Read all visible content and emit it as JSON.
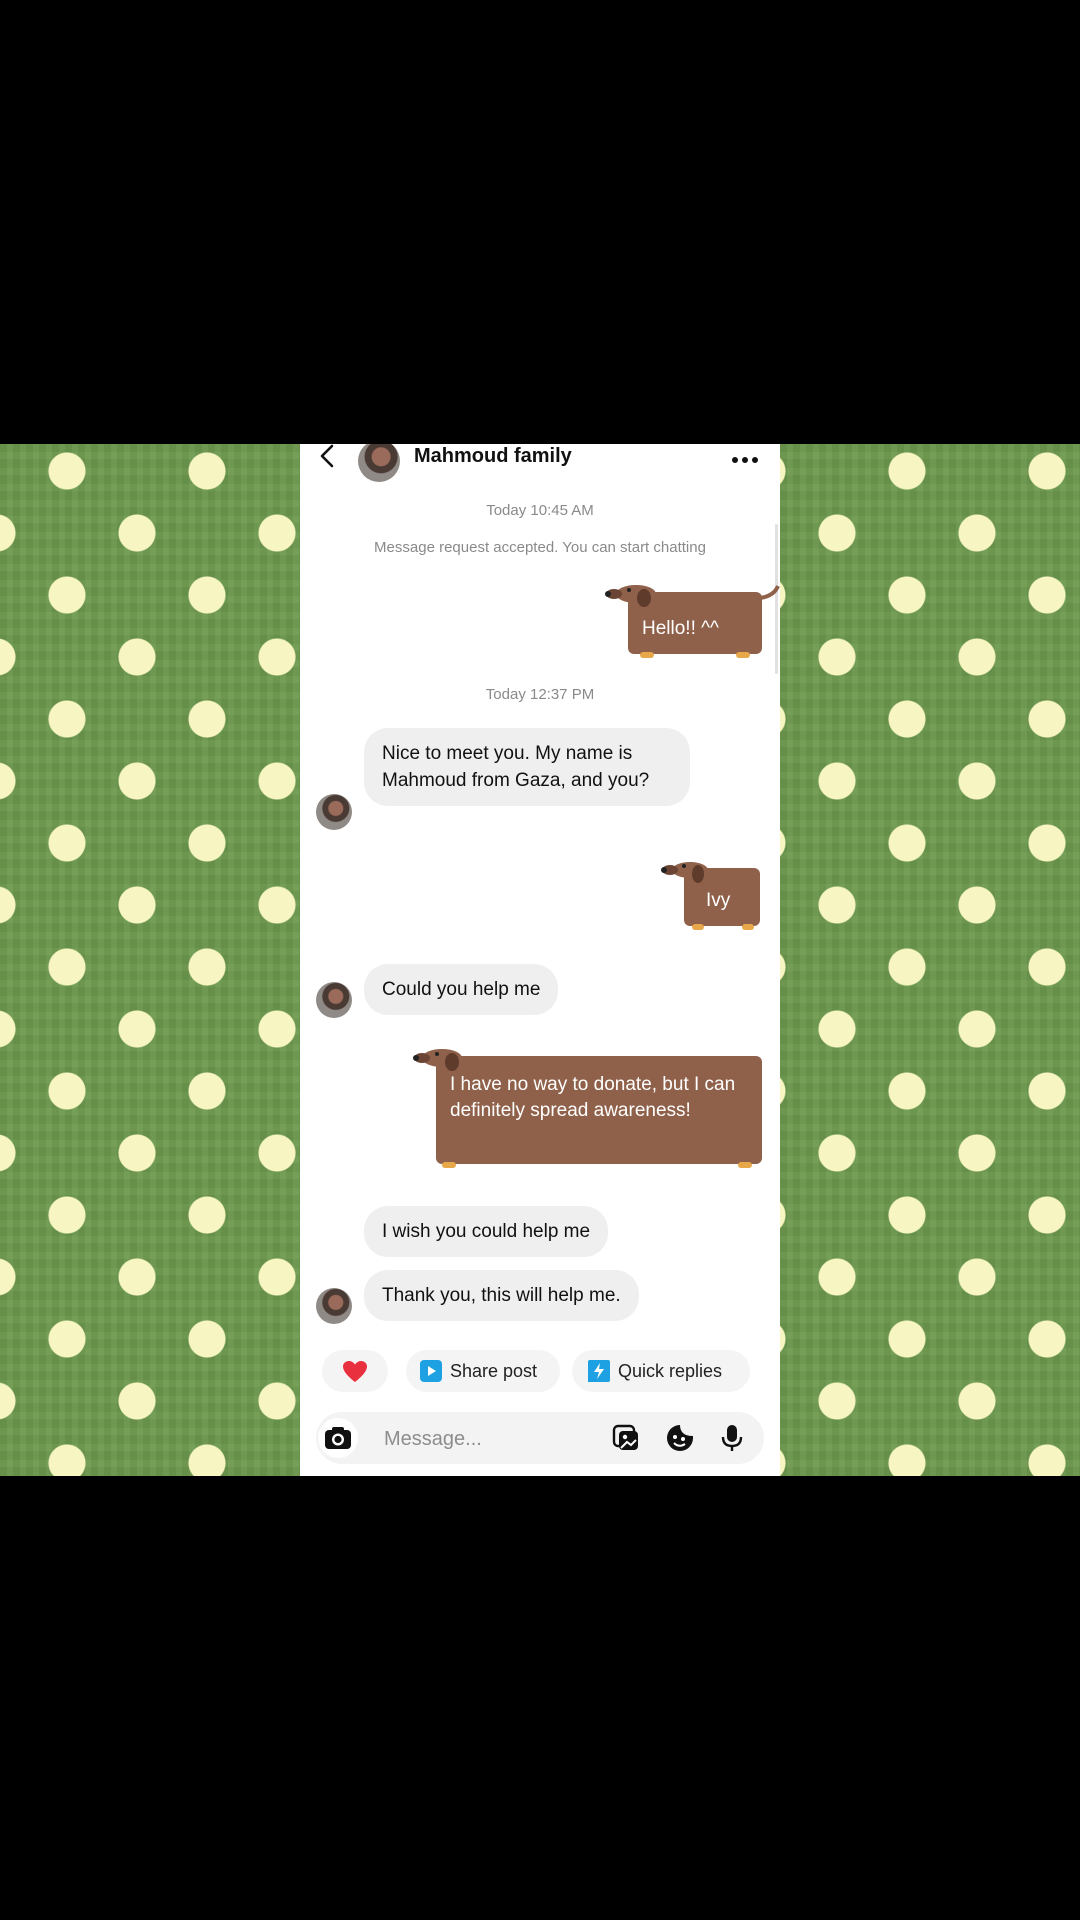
{
  "conversation": {
    "contact_name": "Mahmoud family"
  },
  "thread": {
    "timestamp_1": "Today 10:45 AM",
    "system_message": "Message request accepted. You can start chatting",
    "timestamp_2": "Today 12:37 PM"
  },
  "messages": [
    {
      "sender": "me",
      "text": "Hello!! ^^"
    },
    {
      "sender": "them",
      "text": "Nice to meet you. My name is Mahmoud from Gaza, and you?"
    },
    {
      "sender": "me",
      "text": "Ivy"
    },
    {
      "sender": "them",
      "text": "Could you help me"
    },
    {
      "sender": "me",
      "text": "I have no way to donate, but I can definitely spread awareness!"
    },
    {
      "sender": "them",
      "text": "I wish you could help me"
    },
    {
      "sender": "them",
      "text": "Thank you, this will help me."
    }
  ],
  "quick_actions": {
    "share_post": "Share post",
    "quick_replies": "Quick replies"
  },
  "composer": {
    "placeholder": "Message..."
  },
  "icons": {
    "back": "chevron-left-icon",
    "more": "more-horizontal-icon",
    "heart": "heart-icon",
    "share_post": "play-square-icon",
    "quick_replies": "lightning-icon",
    "camera": "camera-icon",
    "gallery": "gallery-icon",
    "sticker": "sticker-icon",
    "mic": "microphone-icon"
  },
  "colors": {
    "background_green": "#6e9a4f",
    "polka_dot": "#f7f6c3",
    "sent_bubble_brown": "#8f614a",
    "received_bubble": "#efefef",
    "heart_red": "#e8303f",
    "accent_blue": "#1da1e2"
  }
}
